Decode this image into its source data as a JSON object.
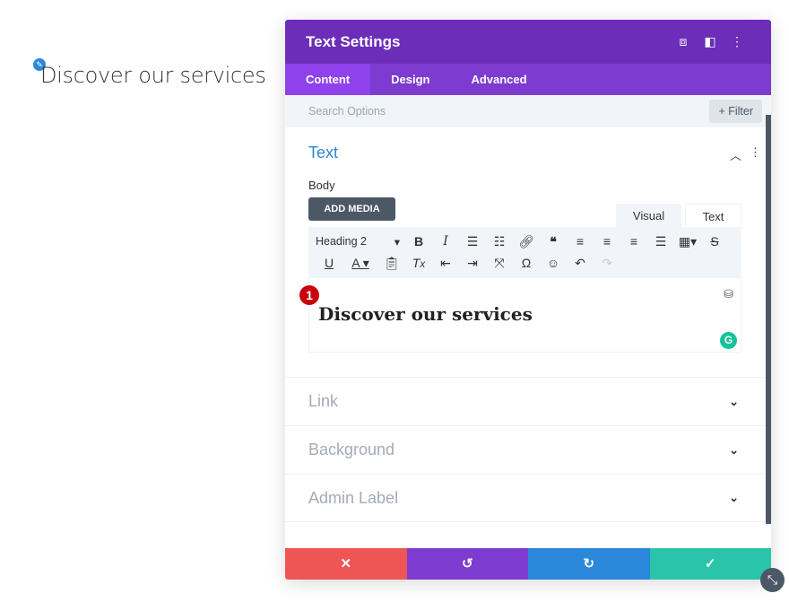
{
  "page": {
    "text": "Discover our services"
  },
  "panel": {
    "title": "Text Settings",
    "tabs": [
      "Content",
      "Design",
      "Advanced"
    ],
    "search_placeholder": "Search Options",
    "filter_label": "+ Filter",
    "text_section": {
      "title": "Text",
      "body_label": "Body",
      "add_media": "ADD MEDIA",
      "visual_tab": "Visual",
      "text_tab": "Text",
      "format_select": "Heading 2",
      "content": "Discover our services",
      "badge": "1"
    },
    "sections": [
      "Link",
      "Background",
      "Admin Label"
    ]
  },
  "colors": {
    "header": "#6c2eb9",
    "tabs": "#7e3bd0",
    "accent": "#2b87da",
    "cancel": "#ef5555",
    "undo": "#7e3bd0",
    "redo": "#2b87da",
    "save": "#29c4a9"
  }
}
